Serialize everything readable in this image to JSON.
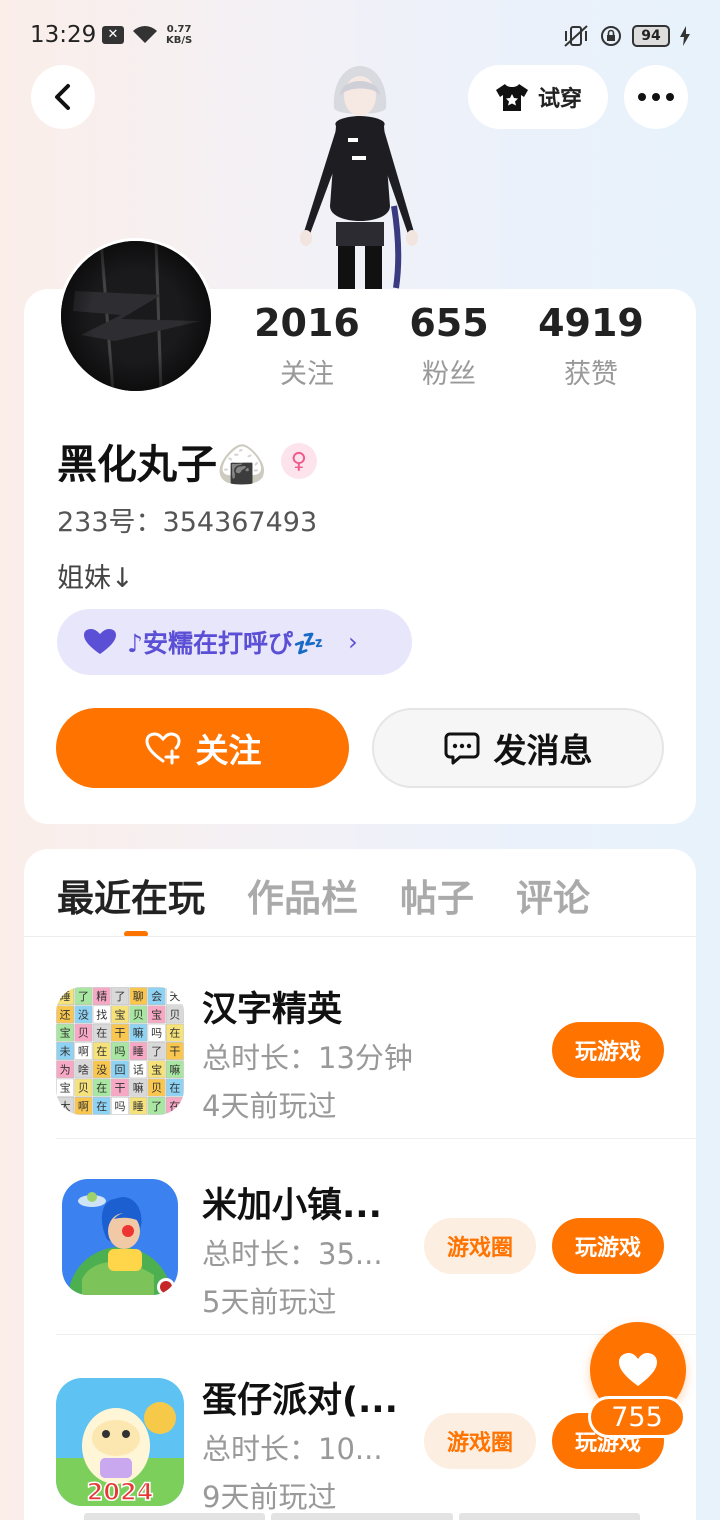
{
  "status_bar": {
    "time": "13:29",
    "speed_value": "0.77",
    "speed_unit": "KB/S",
    "battery": "94"
  },
  "header": {
    "tryon_label": "试穿"
  },
  "profile": {
    "stats": [
      {
        "value": "2016",
        "label": "关注"
      },
      {
        "value": "655",
        "label": "粉丝"
      },
      {
        "value": "4919",
        "label": "获赞"
      }
    ],
    "nickname": "黑化丸子🍙",
    "gender_symbol": "♀",
    "user_id": "233号：354367493",
    "bio": "姐妹↓",
    "status_text": "♪安糯在打呼ぴ💤",
    "follow_label": "关注",
    "message_label": "发消息"
  },
  "tabs": [
    {
      "label": "最近在玩",
      "active": true
    },
    {
      "label": "作品栏",
      "active": false
    },
    {
      "label": "帖子",
      "active": false
    },
    {
      "label": "评论",
      "active": false
    }
  ],
  "games": [
    {
      "name": "汉字精英",
      "duration": "总时长：13分钟",
      "last_played": "4天前玩过",
      "play_label": "玩游戏",
      "circle_label": ""
    },
    {
      "name": "米加小镇...",
      "duration": "总时长：35...",
      "last_played": "5天前玩过",
      "play_label": "玩游戏",
      "circle_label": "游戏圈"
    },
    {
      "name": "蛋仔派对(...",
      "duration": "总时长：10...",
      "last_played": "9天前玩过",
      "play_label": "玩游戏",
      "circle_label": "游戏圈"
    }
  ],
  "game1_grid": [
    "睡",
    "了",
    "精",
    "了",
    "聊",
    "会",
    "天",
    "还",
    "没",
    "找",
    "宝",
    "贝",
    "宝",
    "贝",
    "宝",
    "贝",
    "在",
    "干",
    "嘛",
    "吗",
    "在",
    "未",
    "啊",
    "在",
    "吗",
    "睡",
    "了",
    "干",
    "为",
    "啥",
    "没",
    "回",
    "话",
    "宝",
    "嘛",
    "宝",
    "贝",
    "在",
    "干",
    "嘛",
    "贝",
    "在",
    "大",
    "啊",
    "在",
    "吗",
    "睡",
    "了",
    "在"
  ],
  "game3_badge": "2024",
  "like": {
    "count": "755"
  },
  "colors": {
    "accent": "#ff7300",
    "status_pill_bg": "#e8e6fb",
    "status_pill_text": "#5b4fd6"
  }
}
